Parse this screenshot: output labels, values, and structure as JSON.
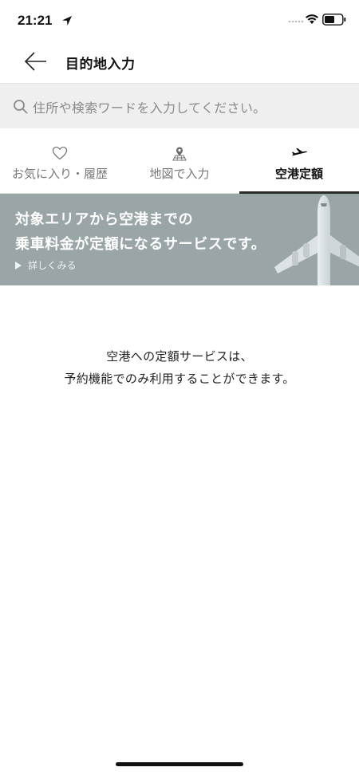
{
  "status_bar": {
    "time": "21:21",
    "icons": [
      "location-arrow-icon",
      "cellular-signal-icon",
      "wifi-icon",
      "battery-icon"
    ]
  },
  "header": {
    "back_icon": "back-arrow-icon",
    "title": "目的地入力"
  },
  "search": {
    "icon": "search-icon",
    "placeholder": "住所や検索ワードを入力してください。"
  },
  "tabs": [
    {
      "label": "お気に入り・履歴",
      "icon": "heart-icon",
      "active": false
    },
    {
      "label": "地図で入力",
      "icon": "map-pin-icon",
      "active": false
    },
    {
      "label": "空港定額",
      "icon": "airplane-icon",
      "active": true
    }
  ],
  "banner": {
    "line1": "対象エリアから空港までの",
    "line2": "乗車料金が定額になるサービスです。",
    "more_label": "詳しくみる",
    "background": "#9aa5a8",
    "image_icon": "airplane-image"
  },
  "message": {
    "line1": "空港への定額サービスは、",
    "line2": "予約機能でのみ利用することができます。"
  },
  "colors": {
    "accent": "#2a2a2a",
    "search_bg": "#efefef",
    "muted_text": "#777777"
  }
}
